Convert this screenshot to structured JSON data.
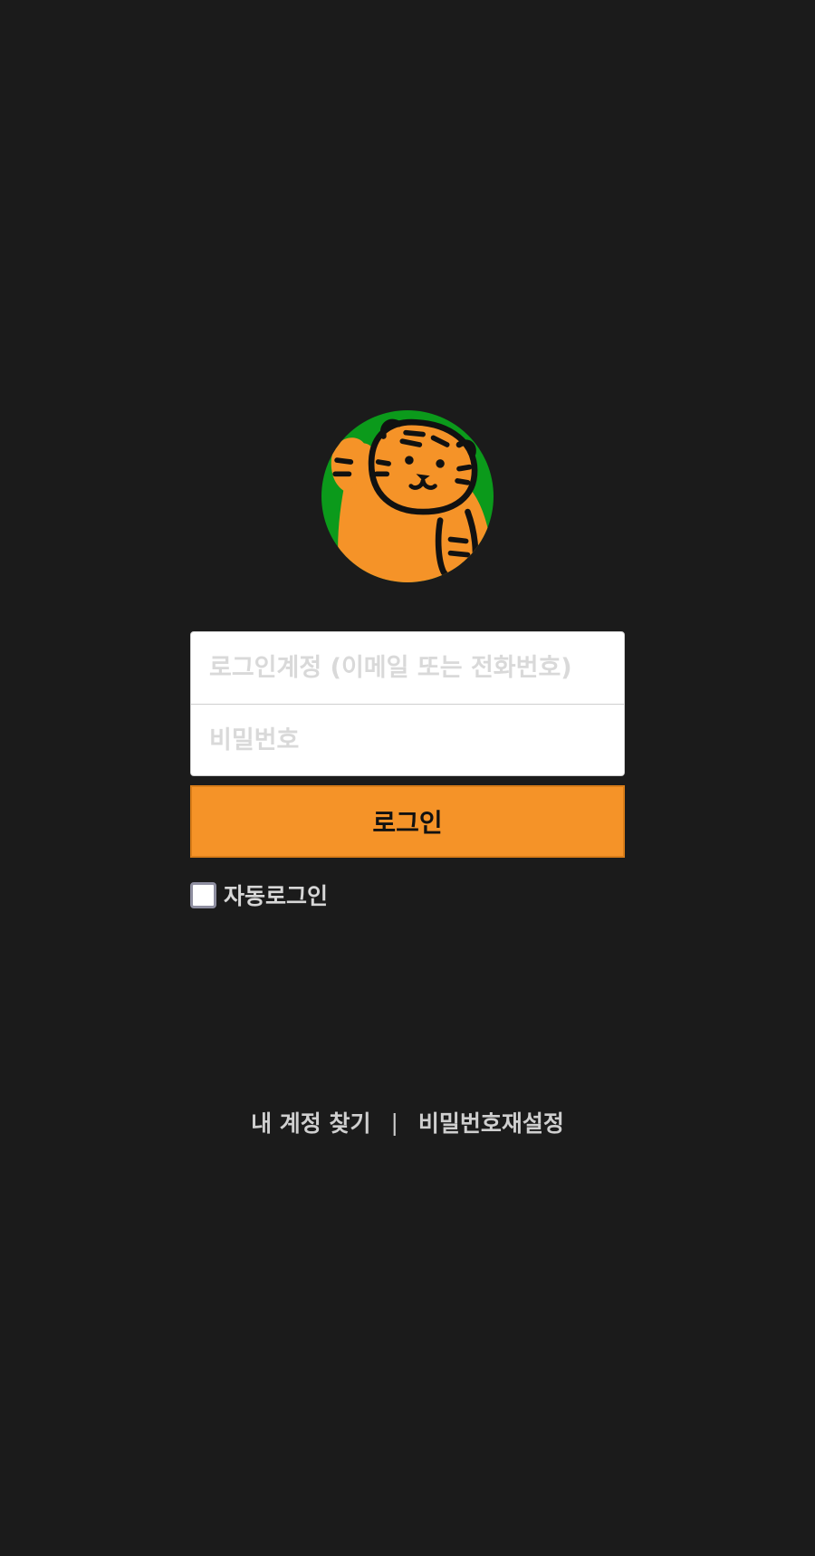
{
  "logo": {
    "icon": "tiger-mascot-icon",
    "colors": {
      "background": "#0b9a1b",
      "body": "#f59328",
      "stroke": "#111111"
    }
  },
  "login": {
    "account_placeholder": "로그인계정 (이메일 또는 전화번호)",
    "password_placeholder": "비밀번호",
    "submit_label": "로그인",
    "auto_login_label": "자동로그인",
    "auto_login_checked": false
  },
  "footer": {
    "find_account": "내 계정 찾기",
    "separator": "|",
    "reset_password": "비밀번호재설정"
  },
  "colors": {
    "page_background": "#1b1b1b",
    "accent": "#f59328",
    "text_light": "#cfcfcf"
  }
}
